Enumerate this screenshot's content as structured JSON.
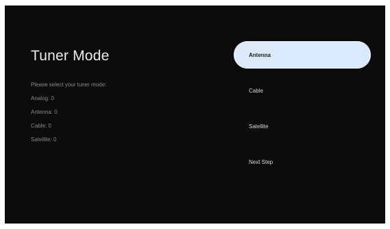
{
  "screen": {
    "title": "Tuner Mode",
    "prompt": "Please select your tuner mode:",
    "counts": [
      {
        "label": "Analog: 0"
      },
      {
        "label": "Antenna: 0"
      },
      {
        "label": "Cable: 0"
      },
      {
        "label": "Satellite: 0"
      }
    ]
  },
  "menu": {
    "selected_index": 0,
    "items": [
      {
        "label": "Antenna"
      },
      {
        "label": "Cable"
      },
      {
        "label": "Satellite"
      },
      {
        "label": "Next Step"
      }
    ]
  },
  "colors": {
    "background": "#0b0b0b",
    "selected_item": "#dbeafa",
    "text_primary": "#ededed",
    "text_secondary": "#8a8a8a"
  }
}
